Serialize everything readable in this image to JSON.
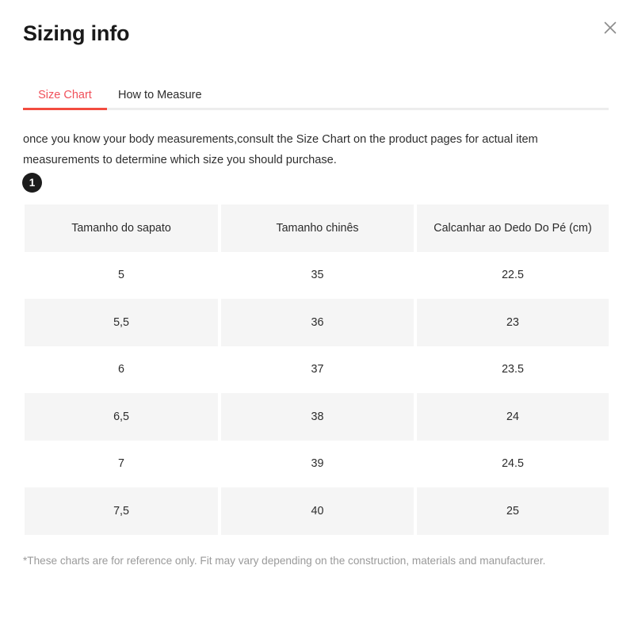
{
  "modal": {
    "title": "Sizing info",
    "close_icon": "close-icon",
    "close_label": "Close"
  },
  "tabs": {
    "items": [
      {
        "label": "Size Chart",
        "active": true
      },
      {
        "label": "How to Measure",
        "active": false
      }
    ],
    "active_color": "#f24c3f"
  },
  "description": {
    "text": "once you know your body measurements,consult the Size Chart on the product pages for actual item measurements to determine which size you should purchase."
  },
  "step": {
    "number": "1"
  },
  "chart_data": {
    "type": "table",
    "title": "Sizing info",
    "columns": [
      "Tamanho do sapato",
      "Tamanho chinês",
      "Calcanhar ao Dedo Do Pé (cm)"
    ],
    "rows": [
      [
        "5",
        "35",
        "22.5"
      ],
      [
        "5,5",
        "36",
        "23"
      ],
      [
        "6",
        "37",
        "23.5"
      ],
      [
        "6,5",
        "38",
        "24"
      ],
      [
        "7",
        "39",
        "24.5"
      ],
      [
        "7,5",
        "40",
        "25"
      ]
    ]
  },
  "footer": {
    "note": "*These charts are for reference only. Fit may vary depending on the construction, materials and manufacturer."
  },
  "colors": {
    "accent": "#f24c3f",
    "tab_active_text": "#f0505a",
    "row_shade": "#f5f5f5",
    "badge_bg": "#1c1c1c",
    "footer_text": "#9a9a9a"
  }
}
